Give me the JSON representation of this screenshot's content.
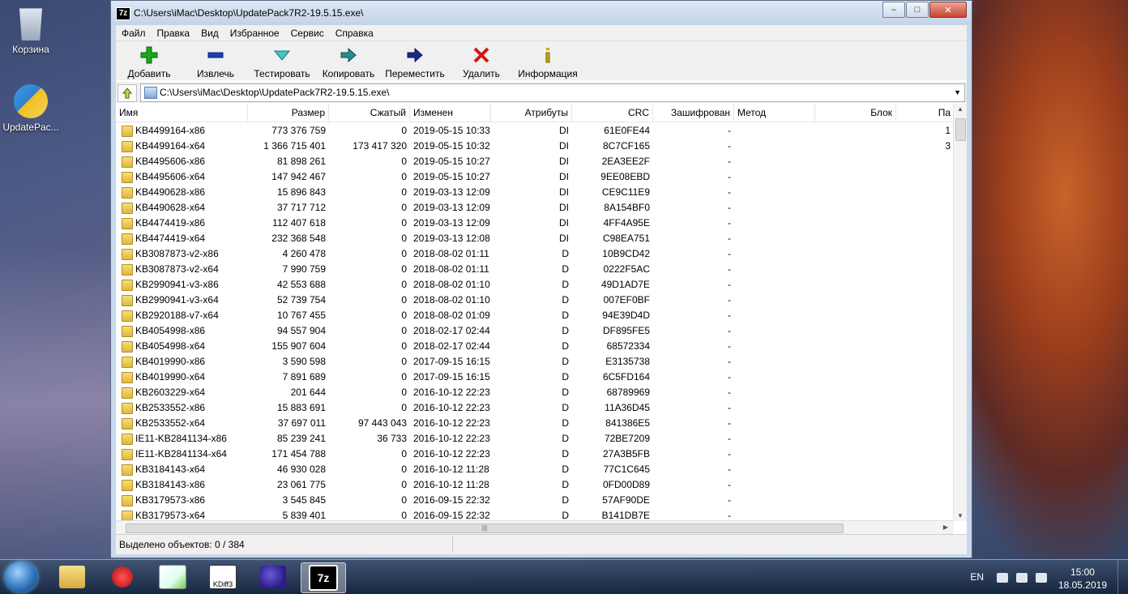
{
  "desktop": {
    "icons": [
      {
        "label": "Корзина",
        "icon": "recycle-bin-icon"
      },
      {
        "label": "UpdatePac...",
        "icon": "windows-update-icon"
      }
    ]
  },
  "window": {
    "app_icon_text": "7z",
    "title": "C:\\Users\\iMac\\Desktop\\UpdatePack7R2-19.5.15.exe\\",
    "controls": {
      "minimize": "–",
      "maximize": "□",
      "close": "✕"
    }
  },
  "menu": [
    "Файл",
    "Правка",
    "Вид",
    "Избранное",
    "Сервис",
    "Справка"
  ],
  "toolbar": [
    {
      "label": "Добавить",
      "icon": "add-icon",
      "color": "#1aa71a"
    },
    {
      "label": "Извлечь",
      "icon": "extract-icon",
      "color": "#1a3fb8"
    },
    {
      "label": "Тестировать",
      "icon": "test-icon",
      "color": "#18a6a6"
    },
    {
      "label": "Копировать",
      "icon": "copy-icon",
      "color": "#1a7a7a"
    },
    {
      "label": "Переместить",
      "icon": "move-icon",
      "color": "#1a2a8a"
    },
    {
      "label": "Удалить",
      "icon": "delete-icon",
      "color": "#d01818"
    },
    {
      "label": "Информация",
      "icon": "info-icon",
      "color": "#c8a800"
    }
  ],
  "address": {
    "path": "C:\\Users\\iMac\\Desktop\\UpdatePack7R2-19.5.15.exe\\"
  },
  "columns": [
    "Имя",
    "Размер",
    "Сжатый",
    "Изменен",
    "Атрибуты",
    "CRC",
    "Зашифрован",
    "Метод",
    "Блок",
    "Па"
  ],
  "rows": [
    {
      "name": "KB4499164-x86",
      "size": "773 376 759",
      "packed": "0",
      "modified": "2019-05-15 10:33",
      "attr": "DI",
      "crc": "61E0FE44",
      "enc": "-",
      "extra": "1"
    },
    {
      "name": "KB4499164-x64",
      "size": "1 366 715 401",
      "packed": "173 417 320",
      "modified": "2019-05-15 10:32",
      "attr": "DI",
      "crc": "8C7CF165",
      "enc": "-",
      "extra": "3"
    },
    {
      "name": "KB4495606-x86",
      "size": "81 898 261",
      "packed": "0",
      "modified": "2019-05-15 10:27",
      "attr": "DI",
      "crc": "2EA3EE2F",
      "enc": "-",
      "extra": ""
    },
    {
      "name": "KB4495606-x64",
      "size": "147 942 467",
      "packed": "0",
      "modified": "2019-05-15 10:27",
      "attr": "DI",
      "crc": "9EE08EBD",
      "enc": "-",
      "extra": ""
    },
    {
      "name": "KB4490628-x86",
      "size": "15 896 843",
      "packed": "0",
      "modified": "2019-03-13 12:09",
      "attr": "DI",
      "crc": "CE9C11E9",
      "enc": "-",
      "extra": ""
    },
    {
      "name": "KB4490628-x64",
      "size": "37 717 712",
      "packed": "0",
      "modified": "2019-03-13 12:09",
      "attr": "DI",
      "crc": "8A154BF0",
      "enc": "-",
      "extra": ""
    },
    {
      "name": "KB4474419-x86",
      "size": "112 407 618",
      "packed": "0",
      "modified": "2019-03-13 12:09",
      "attr": "DI",
      "crc": "4FF4A95E",
      "enc": "-",
      "extra": ""
    },
    {
      "name": "KB4474419-x64",
      "size": "232 368 548",
      "packed": "0",
      "modified": "2019-03-13 12:08",
      "attr": "DI",
      "crc": "C98EA751",
      "enc": "-",
      "extra": ""
    },
    {
      "name": "KB3087873-v2-x86",
      "size": "4 260 478",
      "packed": "0",
      "modified": "2018-08-02 01:11",
      "attr": "D",
      "crc": "10B9CD42",
      "enc": "-",
      "extra": ""
    },
    {
      "name": "KB3087873-v2-x64",
      "size": "7 990 759",
      "packed": "0",
      "modified": "2018-08-02 01:11",
      "attr": "D",
      "crc": "0222F5AC",
      "enc": "-",
      "extra": ""
    },
    {
      "name": "KB2990941-v3-x86",
      "size": "42 553 688",
      "packed": "0",
      "modified": "2018-08-02 01:10",
      "attr": "D",
      "crc": "49D1AD7E",
      "enc": "-",
      "extra": ""
    },
    {
      "name": "KB2990941-v3-x64",
      "size": "52 739 754",
      "packed": "0",
      "modified": "2018-08-02 01:10",
      "attr": "D",
      "crc": "007EF0BF",
      "enc": "-",
      "extra": ""
    },
    {
      "name": "KB2920188-v7-x64",
      "size": "10 767 455",
      "packed": "0",
      "modified": "2018-08-02 01:09",
      "attr": "D",
      "crc": "94E39D4D",
      "enc": "-",
      "extra": ""
    },
    {
      "name": "KB4054998-x86",
      "size": "94 557 904",
      "packed": "0",
      "modified": "2018-02-17 02:44",
      "attr": "D",
      "crc": "DF895FE5",
      "enc": "-",
      "extra": ""
    },
    {
      "name": "KB4054998-x64",
      "size": "155 907 604",
      "packed": "0",
      "modified": "2018-02-17 02:44",
      "attr": "D",
      "crc": "68572334",
      "enc": "-",
      "extra": ""
    },
    {
      "name": "KB4019990-x86",
      "size": "3 590 598",
      "packed": "0",
      "modified": "2017-09-15 16:15",
      "attr": "D",
      "crc": "E3135738",
      "enc": "-",
      "extra": ""
    },
    {
      "name": "KB4019990-x64",
      "size": "7 891 689",
      "packed": "0",
      "modified": "2017-09-15 16:15",
      "attr": "D",
      "crc": "6C5FD164",
      "enc": "-",
      "extra": ""
    },
    {
      "name": "KB2603229-x64",
      "size": "201 644",
      "packed": "0",
      "modified": "2016-10-12 22:23",
      "attr": "D",
      "crc": "68789969",
      "enc": "-",
      "extra": ""
    },
    {
      "name": "KB2533552-x86",
      "size": "15 883 691",
      "packed": "0",
      "modified": "2016-10-12 22:23",
      "attr": "D",
      "crc": "11A36D45",
      "enc": "-",
      "extra": ""
    },
    {
      "name": "KB2533552-x64",
      "size": "37 697 011",
      "packed": "97 443 043",
      "modified": "2016-10-12 22:23",
      "attr": "D",
      "crc": "841386E5",
      "enc": "-",
      "extra": ""
    },
    {
      "name": "IE11-KB2841134-x86",
      "size": "85 239 241",
      "packed": "36 733",
      "modified": "2016-10-12 22:23",
      "attr": "D",
      "crc": "72BE7209",
      "enc": "-",
      "extra": ""
    },
    {
      "name": "IE11-KB2841134-x64",
      "size": "171 454 788",
      "packed": "0",
      "modified": "2016-10-12 22:23",
      "attr": "D",
      "crc": "27A3B5FB",
      "enc": "-",
      "extra": ""
    },
    {
      "name": "KB3184143-x64",
      "size": "46 930 028",
      "packed": "0",
      "modified": "2016-10-12 11:28",
      "attr": "D",
      "crc": "77C1C645",
      "enc": "-",
      "extra": ""
    },
    {
      "name": "KB3184143-x86",
      "size": "23 061 775",
      "packed": "0",
      "modified": "2016-10-12 11:28",
      "attr": "D",
      "crc": "0FD00D89",
      "enc": "-",
      "extra": ""
    },
    {
      "name": "KB3179573-x86",
      "size": "3 545 845",
      "packed": "0",
      "modified": "2016-09-15 22:32",
      "attr": "D",
      "crc": "57AF90DE",
      "enc": "-",
      "extra": ""
    },
    {
      "name": "KB3179573-x64",
      "size": "5 839 401",
      "packed": "0",
      "modified": "2016-09-15 22:32",
      "attr": "D",
      "crc": "B141DB7E",
      "enc": "-",
      "extra": ""
    }
  ],
  "status": {
    "selected": "Выделено объектов: 0 / 384"
  },
  "taskbar": {
    "apps": [
      {
        "icon": "start-orb-icon"
      },
      {
        "icon": "file-explorer-icon"
      },
      {
        "icon": "ccleaner-icon"
      },
      {
        "icon": "notepad-plus-icon"
      },
      {
        "icon": "kdiff3-icon",
        "text": "KDiff3"
      },
      {
        "icon": "cpp-app-icon"
      },
      {
        "icon": "7zip-icon",
        "text": "7z",
        "active": true
      }
    ],
    "lang": "EN",
    "time": "15:00",
    "date": "18.05.2019"
  }
}
